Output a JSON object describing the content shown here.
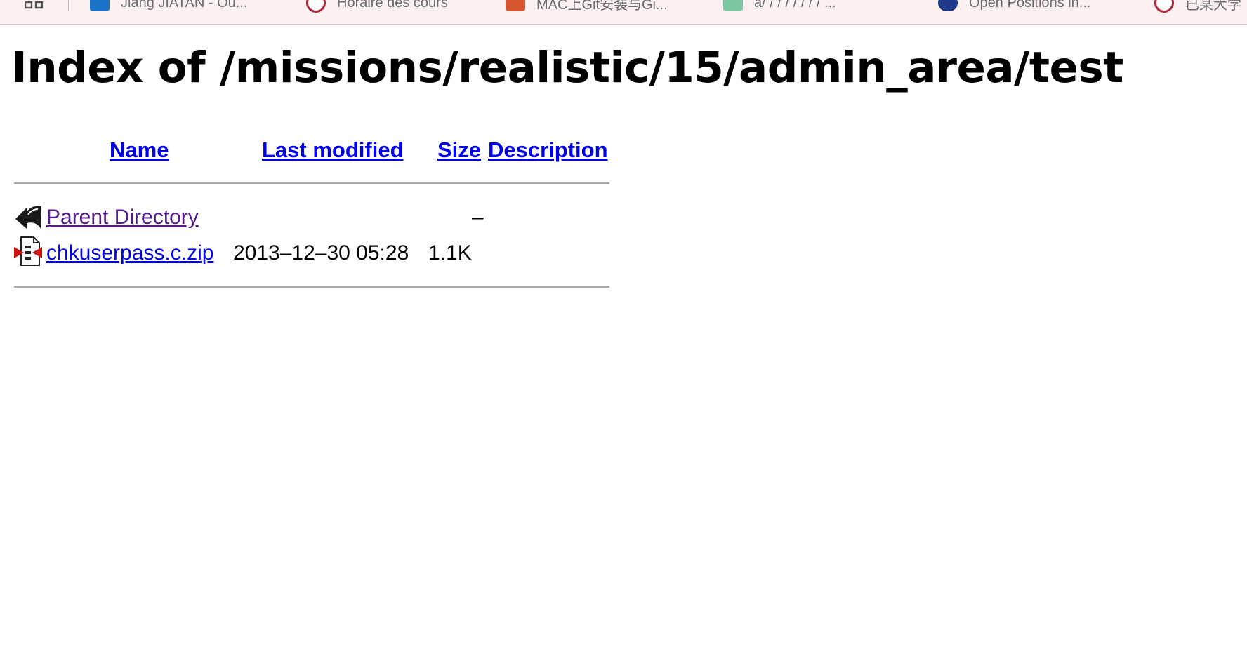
{
  "bookmarks": [
    {
      "label": "Jiang JIATAN - Ou...",
      "icon": "outlook-icon",
      "color": "#1a73c8"
    },
    {
      "label": "Horaire des cours",
      "icon": "red-logo-icon",
      "color": "#a72839"
    },
    {
      "label": "MAC上Git安装与Gi...",
      "icon": "orange-logo-icon",
      "color": "#d6562f"
    },
    {
      "label": "a/ / / / / / / / ...",
      "icon": "green-logo-icon",
      "color": "#4caf7c"
    },
    {
      "label": "Open Positions in...",
      "icon": "globe-icon",
      "color": "#1f3a8a"
    },
    {
      "label": "已某大学",
      "icon": "red-logo-icon",
      "color": "#a72839"
    }
  ],
  "page": {
    "title": "Index of /missions/realistic/15/admin_area/test"
  },
  "table": {
    "headers": {
      "name": "Name",
      "last_modified": "Last modified",
      "size": "Size",
      "description": "Description"
    },
    "rows": [
      {
        "name": "Parent Directory",
        "last_modified": "",
        "size": "–",
        "description": "",
        "icon": "back-arrow-icon",
        "visited": true
      },
      {
        "name": "chkuserpass.c.zip",
        "last_modified": "2013–12–30 05:28",
        "size": "1.1K",
        "description": "",
        "icon": "compressed-file-icon",
        "visited": false
      }
    ]
  }
}
